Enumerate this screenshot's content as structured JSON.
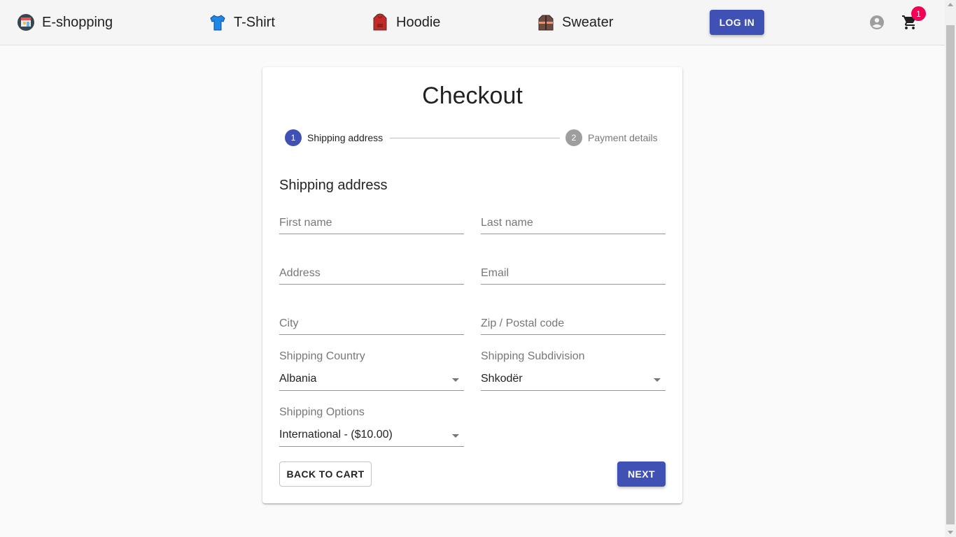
{
  "nav": {
    "brand": {
      "label": "E-shopping",
      "icon": "shop-icon"
    },
    "items": [
      {
        "label": "T-Shirt",
        "icon": "tshirt-icon"
      },
      {
        "label": "Hoodie",
        "icon": "hoodie-icon"
      },
      {
        "label": "Sweater",
        "icon": "sweater-icon"
      }
    ],
    "login_label": "LOG IN",
    "account_icon": "account-circle-icon",
    "cart_icon": "shopping-cart-icon",
    "cart_count": "1"
  },
  "checkout": {
    "title": "Checkout",
    "steps": [
      {
        "number": "1",
        "label": "Shipping address",
        "active": true
      },
      {
        "number": "2",
        "label": "Payment details",
        "active": false
      }
    ],
    "section_title": "Shipping address",
    "fields": {
      "first_name": {
        "placeholder": "First name",
        "value": ""
      },
      "last_name": {
        "placeholder": "Last name",
        "value": ""
      },
      "address": {
        "placeholder": "Address",
        "value": ""
      },
      "email": {
        "placeholder": "Email",
        "value": ""
      },
      "city": {
        "placeholder": "City",
        "value": ""
      },
      "zip": {
        "placeholder": "Zip / Postal code",
        "value": ""
      }
    },
    "selects": {
      "country": {
        "label": "Shipping Country",
        "value": "Albania"
      },
      "subdivision": {
        "label": "Shipping Subdivision",
        "value": "Shkodër"
      },
      "options": {
        "label": "Shipping Options",
        "value": "International - ($10.00)"
      }
    },
    "back_label": "BACK TO CART",
    "next_label": "NEXT"
  },
  "colors": {
    "primary": "#3f51b5",
    "badge": "#f50057",
    "step_inactive": "#9e9e9e"
  }
}
